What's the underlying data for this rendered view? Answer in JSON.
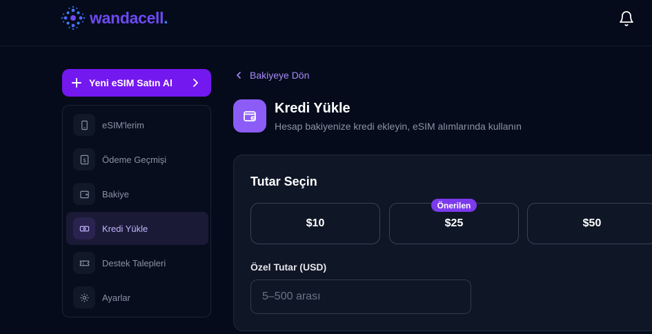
{
  "header": {
    "logo_text": "wandacell",
    "logo_dot": ".",
    "bell_icon": "bell-icon"
  },
  "sidebar": {
    "buy_button_label": "Yeni eSIM Satın Al",
    "items": [
      {
        "label": "eSIM'lerim",
        "icon": "phone-icon",
        "active": false
      },
      {
        "label": "Ödeme Geçmişi",
        "icon": "receipt-icon",
        "active": false
      },
      {
        "label": "Bakiye",
        "icon": "wallet-icon",
        "active": false
      },
      {
        "label": "Kredi Yükle",
        "icon": "money-icon",
        "active": true
      },
      {
        "label": "Destek Talepleri",
        "icon": "ticket-icon",
        "active": false
      },
      {
        "label": "Ayarlar",
        "icon": "gear-icon",
        "active": false
      }
    ]
  },
  "main": {
    "back_label": "Bakiyeye Dön",
    "title": "Kredi Yükle",
    "subtitle": "Hesap bakiyenize kredi ekleyin, eSIM alımlarında kullanın",
    "card": {
      "title": "Tutar Seçin",
      "amounts": [
        "$10",
        "$25",
        "$50"
      ],
      "recommended_badge": "Önerilen",
      "custom_label": "Özel Tutar (USD)",
      "custom_placeholder": "5–500 arası"
    }
  },
  "colors": {
    "background": "#050b1a",
    "accent": "#7418f0",
    "accent_light": "#8b5cf6",
    "active_text": "#c4b5fd"
  }
}
